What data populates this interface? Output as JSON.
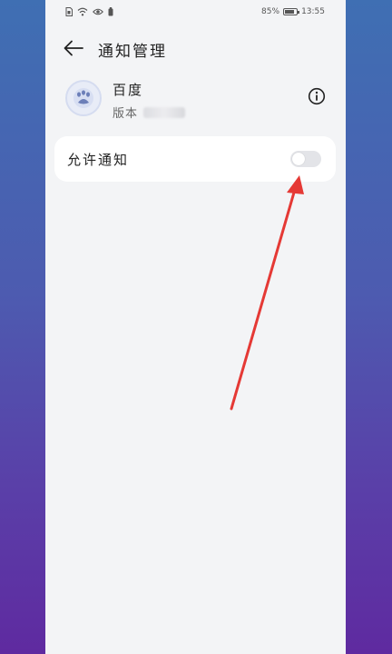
{
  "status_bar": {
    "battery_percent": "85%",
    "time": "13:55"
  },
  "header": {
    "title": "通知管理"
  },
  "app": {
    "name": "百度",
    "version_label": "版本"
  },
  "settings": {
    "allow_notifications_label": "允许通知",
    "allow_notifications_enabled": false
  },
  "colors": {
    "annotation_arrow": "#e53935",
    "page_background": "#f3f4f6",
    "card_background": "#ffffff",
    "toggle_off": "#e3e4e8"
  },
  "icons": {
    "back": "arrow-left-icon",
    "info": "info-circle-icon",
    "app": "baidu-app-icon",
    "signal": "sim-icon",
    "wifi": "wifi-icon",
    "eye": "eye-comfort-icon",
    "battery": "battery-icon"
  }
}
